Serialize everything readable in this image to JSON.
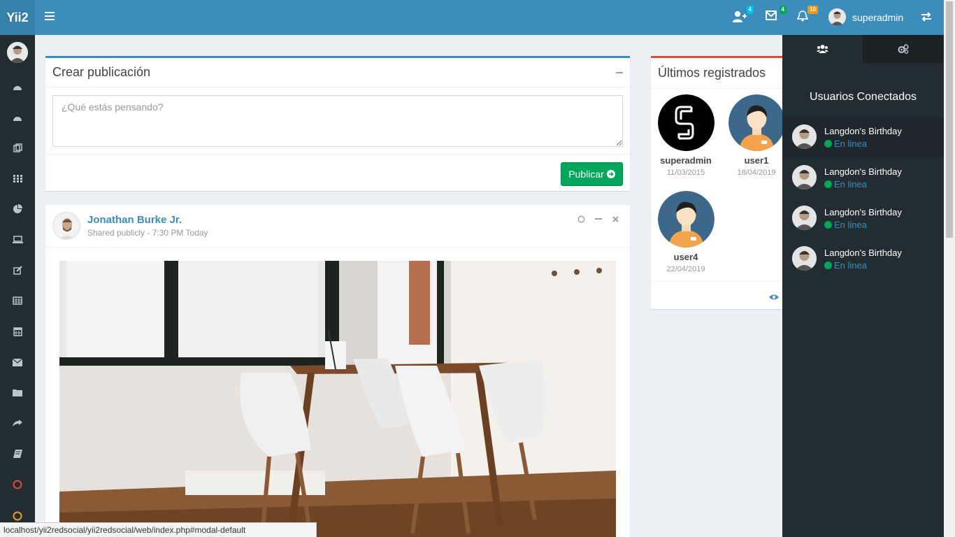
{
  "brand": {
    "logo": "Yii2"
  },
  "header": {
    "badges": {
      "friend_requests": "4",
      "messages": "4",
      "notifications": "10"
    },
    "badge_colors": {
      "friend_requests": "#00c0ef",
      "messages": "#00a65a",
      "notifications": "#f39c12"
    },
    "username": "superadmin"
  },
  "sidebar": {
    "icons": [
      "dashboard-icon",
      "dashboard-icon",
      "files-icon",
      "th-icon",
      "pie-chart-icon",
      "laptop-icon",
      "edit-icon",
      "table-icon",
      "calendar-icon",
      "envelope-icon",
      "folder-icon",
      "share-icon",
      "book-icon",
      "circle-red-icon",
      "circle-yellow-icon"
    ]
  },
  "create_post": {
    "title": "Crear publicación",
    "placeholder": "¿Qué estás pensando?",
    "submit_label": "Publicar"
  },
  "post": {
    "author": "Jonathan Burke Jr.",
    "meta": "Shared publicly - 7:30 PM Today"
  },
  "latest_users": {
    "title": "Últimos registrados",
    "users": [
      {
        "name": "superadmin",
        "date": "11/03/2015"
      },
      {
        "name": "user1",
        "date": "18/04/2019"
      },
      {
        "name": "user4",
        "date": "22/04/2019"
      }
    ]
  },
  "control_sidebar": {
    "heading": "Usuarios Conectados",
    "users": [
      {
        "name": "Langdon's Birthday",
        "status": "En linea"
      },
      {
        "name": "Langdon's Birthday",
        "status": "En linea"
      },
      {
        "name": "Langdon's Birthday",
        "status": "En linea"
      },
      {
        "name": "Langdon's Birthday",
        "status": "En linea"
      }
    ]
  },
  "status_bar": {
    "url": "localhost/yii2redsocial/yii2redsocial/web/index.php#modal-default"
  },
  "colors": {
    "header": "#3c8dbc",
    "logo": "#367fa9",
    "sidebar": "#222d32",
    "success": "#00a65a",
    "danger": "#dd4b39"
  }
}
